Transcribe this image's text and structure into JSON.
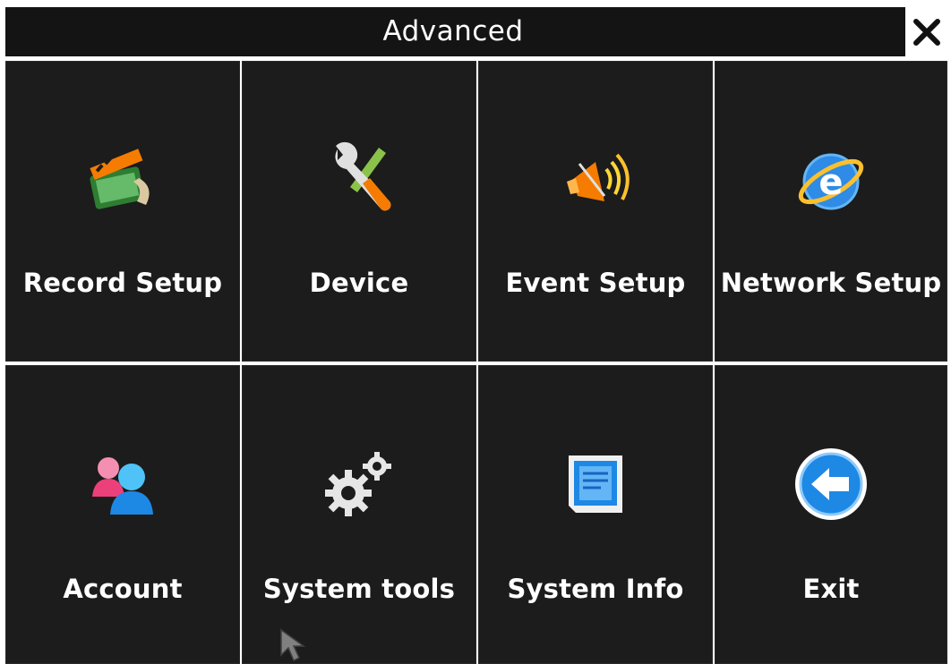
{
  "header": {
    "title": "Advanced",
    "close_icon": "close-icon"
  },
  "menu": {
    "items": [
      {
        "label": "Record Setup",
        "icon": "film-clapper-icon"
      },
      {
        "label": "Device",
        "icon": "wrench-screwdriver-icon"
      },
      {
        "label": "Event Setup",
        "icon": "speaker-alarm-icon"
      },
      {
        "label": "Network Setup",
        "icon": "internet-globe-icon"
      },
      {
        "label": "Account",
        "icon": "users-icon"
      },
      {
        "label": "System tools",
        "icon": "gears-icon"
      },
      {
        "label": "System Info",
        "icon": "info-chip-icon"
      },
      {
        "label": "Exit",
        "icon": "back-arrow-icon"
      }
    ]
  },
  "colors": {
    "background": "#1c1c1c",
    "title_bar": "#141414",
    "text": "#ffffff",
    "divider": "#ffffff"
  }
}
